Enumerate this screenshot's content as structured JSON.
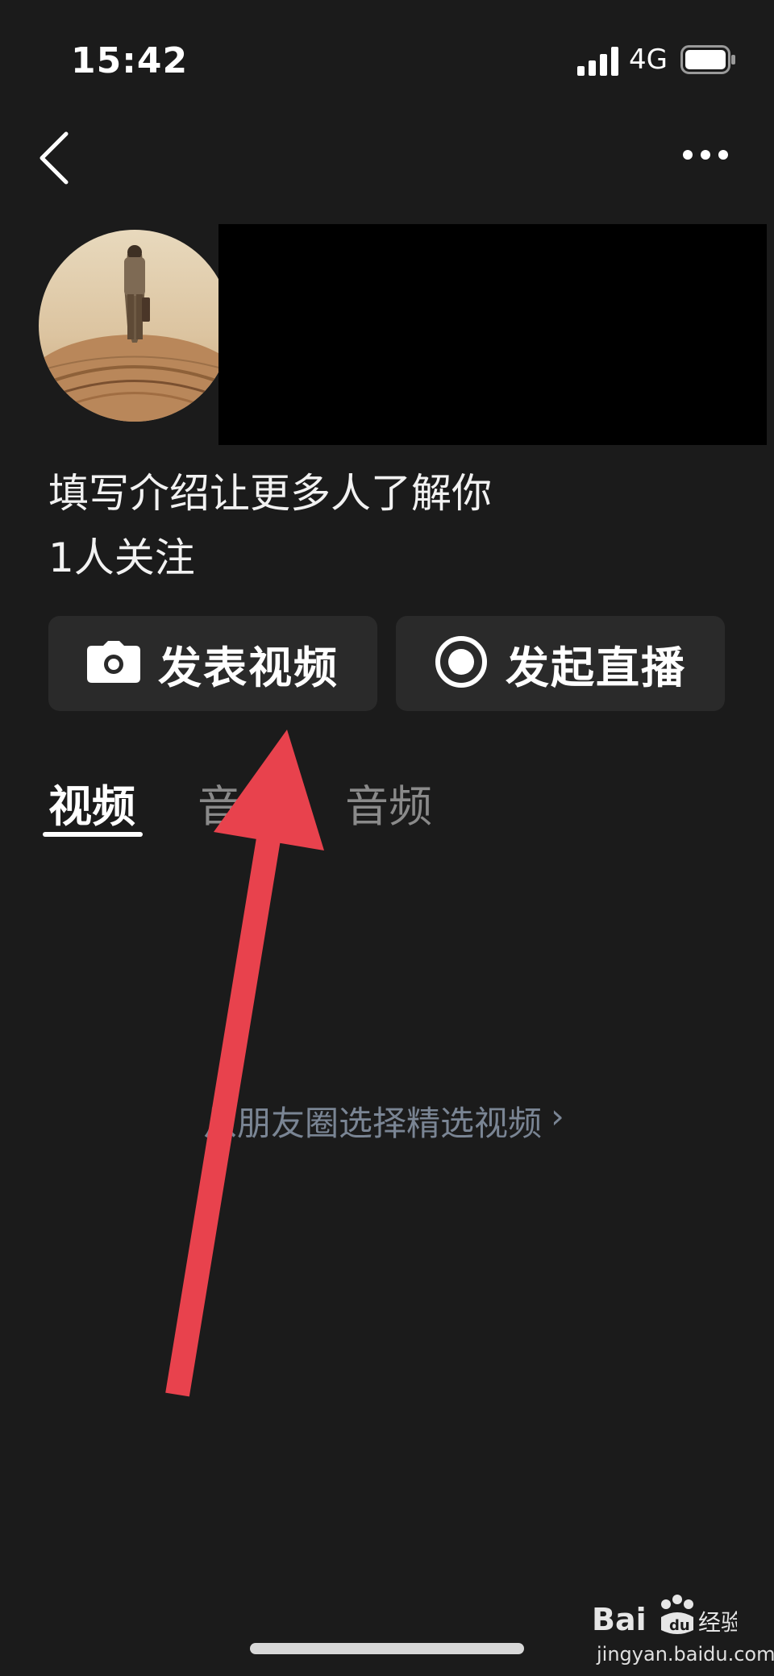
{
  "status_bar": {
    "time": "15:42",
    "network": "4G",
    "icons": [
      "signal-icon",
      "battery-icon"
    ]
  },
  "nav": {
    "icons": [
      "back-icon",
      "more-icon"
    ]
  },
  "profile": {
    "bio_placeholder": "填写介绍让更多人了解你",
    "followers": "1人关注"
  },
  "actions": {
    "publish_video": "发表视频",
    "start_live": "发起直播"
  },
  "tabs": [
    {
      "label": "视频",
      "active": true
    },
    {
      "label": "音乐",
      "active": false
    },
    {
      "label": "音频",
      "active": false
    }
  ],
  "empty_state": {
    "link": "从朋友圈选择精选视频",
    "chevron": "›"
  },
  "watermark": {
    "sub": "jingyan.baidu.com"
  },
  "colors": {
    "background": "#1b1b1b",
    "button_bg": "#2a2a2a",
    "link": "#7a8594",
    "inactive_tab": "#8a8a8a",
    "annotation_arrow": "#e8424d"
  }
}
